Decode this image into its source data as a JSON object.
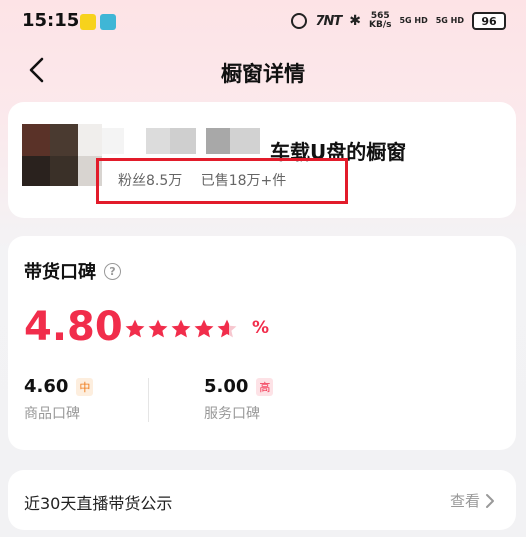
{
  "status_bar": {
    "time": "15:15",
    "nfc_label": "7NT",
    "speed_value": "565",
    "speed_unit": "KB/s",
    "sim1": "5G HD",
    "sim2": "5G HD",
    "battery": "96"
  },
  "nav": {
    "title": "橱窗详情"
  },
  "shop": {
    "name": "车载U盘的橱窗",
    "fans": "粉丝8.5万",
    "sold": "已售18万+件"
  },
  "reputation": {
    "title": "带货口碑",
    "help_icon": "?",
    "score": "4.80",
    "stars_filled": 4.6,
    "percent": "%",
    "product": {
      "value": "4.60",
      "level": "中",
      "label": "商品口碑"
    },
    "service": {
      "value": "5.00",
      "level": "高",
      "label": "服务口碑"
    }
  },
  "live": {
    "title": "近30天直播带货公示",
    "more": "查看"
  },
  "colors": {
    "accent": "#f12d4b",
    "highlight": "#e21b2a",
    "mid_tag": "#ef7a1a"
  }
}
